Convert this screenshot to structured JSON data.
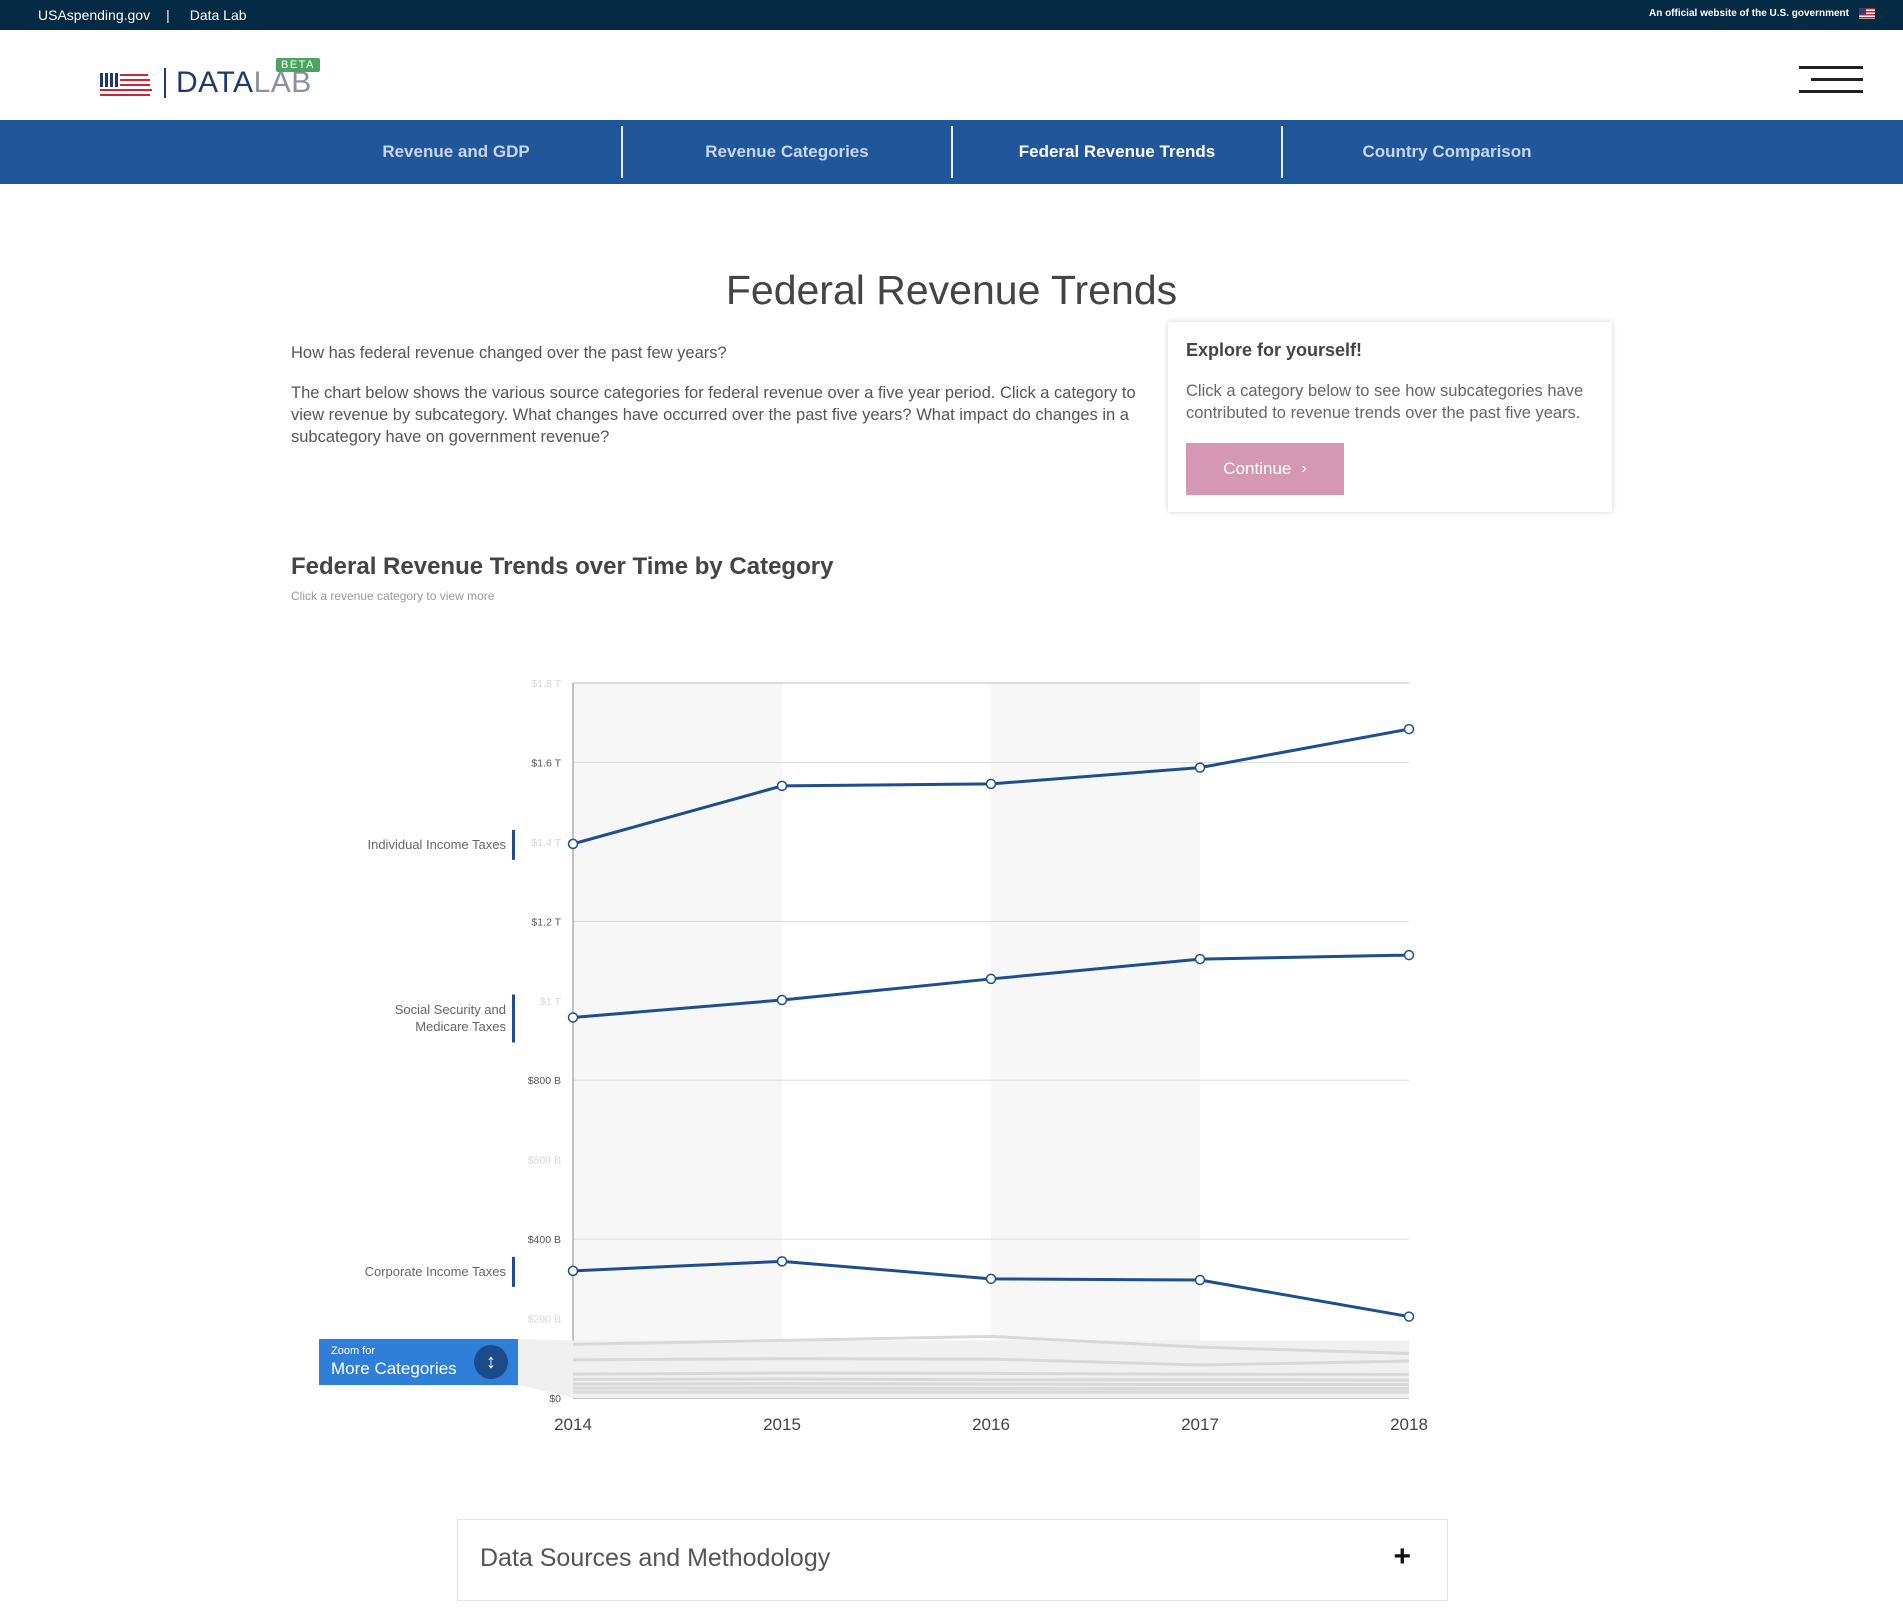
{
  "topbar": {
    "site": "USAspending.gov",
    "section": "Data Lab",
    "official": "An official website of the U.S. government"
  },
  "logo": {
    "data": "DATA",
    "lab": "LAB",
    "badge": "BETA"
  },
  "nav": {
    "items": [
      "Revenue and GDP",
      "Revenue Categories",
      "Federal Revenue Trends",
      "Country Comparison"
    ],
    "active": 2
  },
  "page": {
    "title": "Federal Revenue Trends",
    "intro_q": "How has federal revenue changed over the past few years?",
    "intro_p": "The chart below shows the various source categories for federal revenue over a five year period. Click a category to view revenue by subcategory. What changes have occurred over the past five years? What impact do changes in a subcategory have on government revenue?"
  },
  "explore": {
    "heading": "Explore for yourself!",
    "body": "Click a category below to see how subcategories have contributed to revenue trends over the past five years.",
    "button": "Continue"
  },
  "chart_header": {
    "title": "Federal Revenue Trends over Time by Category",
    "subtitle": "Click a revenue category to view more"
  },
  "zoom": {
    "small": "Zoom for",
    "big": "More Categories"
  },
  "accordion": {
    "label": "Data Sources and Methodology",
    "icon": "+"
  },
  "colors": {
    "line": "#1f4e8c",
    "accent": "#21569b",
    "button": "#d597b2",
    "zoom": "#2f7ed8"
  },
  "chart_data": {
    "type": "line",
    "title": "Federal Revenue Trends over Time by Category",
    "x": [
      "2014",
      "2015",
      "2016",
      "2017",
      "2018"
    ],
    "y_ticks": [
      "$0",
      "$200 B",
      "$400 B",
      "$600 B",
      "$800 B",
      "$1 T",
      "$1.2 T",
      "$1.4 T",
      "$1.6 T",
      "$1.8 T"
    ],
    "ylim": [
      0,
      1800
    ],
    "y_unit": "billions of dollars",
    "series": [
      {
        "name": "Individual Income Taxes",
        "values": [
          1395,
          1541,
          1546,
          1587,
          1684
        ]
      },
      {
        "name": "Social Security and Medicare Taxes",
        "values": [
          958,
          1002,
          1055,
          1105,
          1115
        ]
      },
      {
        "name": "Corporate Income Taxes",
        "values": [
          320,
          344,
          300,
          297,
          205
        ]
      }
    ],
    "minor_series": [
      {
        "values": [
          135,
          145,
          155,
          128,
          112
        ]
      },
      {
        "values": [
          96,
          99,
          98,
          83,
          93
        ]
      },
      {
        "values": [
          60,
          63,
          62,
          60,
          59
        ]
      },
      {
        "values": [
          47,
          48,
          46,
          46,
          45
        ]
      },
      {
        "values": [
          35,
          36,
          35,
          34,
          34
        ]
      },
      {
        "values": [
          25,
          25,
          24,
          24,
          24
        ]
      },
      {
        "values": [
          15,
          15,
          15,
          15,
          15
        ]
      }
    ]
  }
}
